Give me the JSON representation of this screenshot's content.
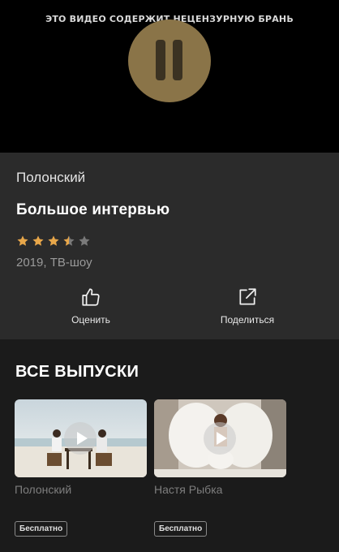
{
  "player": {
    "warning": "ЭТО ВИДЕО СОДЕРЖИТ НЕЦЕНЗУРНУЮ БРАНЬ",
    "state_icon": "pause-icon",
    "accent_color": "#8a7448"
  },
  "info": {
    "show_name": "Полонский",
    "episode_title": "Большое интервью",
    "rating": 3.5,
    "rating_max": 5,
    "meta": "2019, ТВ-шоу",
    "actions": {
      "rate_label": "Оценить",
      "share_label": "Поделиться"
    }
  },
  "episodes": {
    "title": "ВСЕ ВЫПУСКИ",
    "items": [
      {
        "title": "Полонский",
        "badge": "Бесплатно"
      },
      {
        "title": "Настя Рыбка",
        "badge": "Бесплатно"
      }
    ]
  }
}
